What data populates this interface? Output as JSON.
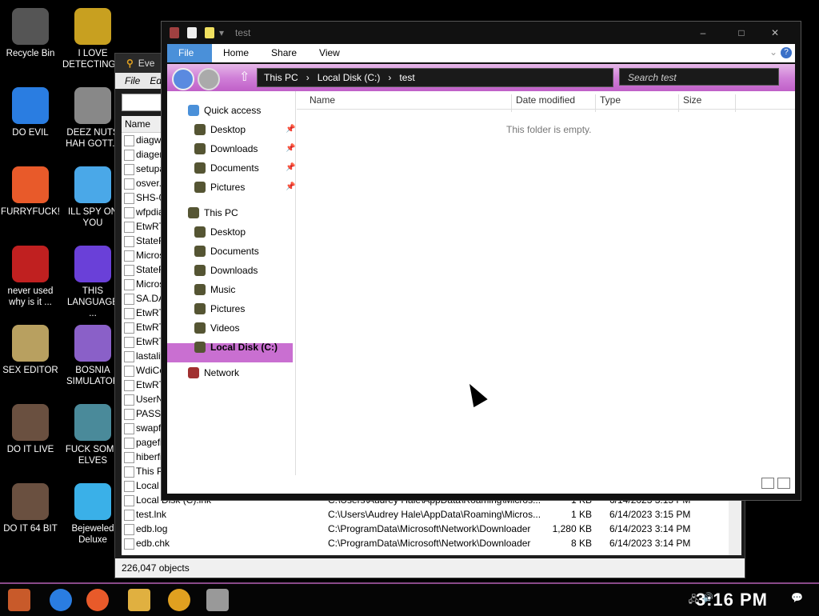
{
  "desktop_icons": [
    {
      "label": "Recycle Bin",
      "icon": "recycle-bin-icon",
      "color": "#555"
    },
    {
      "label": "I LOVE DETECTING...",
      "icon": "detect-it-easy-icon",
      "color": "#c8a020"
    },
    {
      "label": "DO EVIL",
      "icon": "chrome-icon",
      "color": "#2a7de1"
    },
    {
      "label": "DEEZ NUTS HAH GOTT...",
      "icon": "copy-windows-icon",
      "color": "#888"
    },
    {
      "label": "FURRYFUCK!",
      "icon": "firefox-icon",
      "color": "#e85a2a"
    },
    {
      "label": "ILL SPY ON YOU",
      "icon": "network-spy-icon",
      "color": "#4aa8e8"
    },
    {
      "label": "never used why is it ...",
      "icon": "dev-cpp-icon",
      "color": "#c02020"
    },
    {
      "label": "THIS LANGUAGE ...",
      "icon": "goland-icon",
      "color": "#6a40d8"
    },
    {
      "label": "SEX EDITOR",
      "icon": "hxd-icon",
      "color": "#b8a060"
    },
    {
      "label": "BOSNIA SIMULATOR",
      "icon": "mine-icon",
      "color": "#8a60c8"
    },
    {
      "label": "DO IT LIVE",
      "icon": "portrait-icon",
      "color": "#6a5040"
    },
    {
      "label": "FUCK SOME ELVES",
      "icon": "elf-icon",
      "color": "#4a8a9a"
    },
    {
      "label": "DO IT 64 BIT",
      "icon": "portrait-64-icon",
      "color": "#6a5040"
    },
    {
      "label": "Bejeweled Deluxe",
      "icon": "diamond-icon",
      "color": "#3ab0e8"
    }
  ],
  "background_window": {
    "title": "Eve",
    "menu": [
      "File",
      "Ed"
    ],
    "header_name": "Name",
    "rows": [
      {
        "name": "diagwr",
        "path": "",
        "size": "",
        "date": ""
      },
      {
        "name": "diager",
        "path": "",
        "size": "",
        "date": ""
      },
      {
        "name": "setupa",
        "path": "",
        "size": "",
        "date": ""
      },
      {
        "name": "osver.",
        "path": "",
        "size": "",
        "date": ""
      },
      {
        "name": "SHS-0",
        "path": "",
        "size": "",
        "date": ""
      },
      {
        "name": "wfpdia",
        "path": "",
        "size": "",
        "date": ""
      },
      {
        "name": "EtwRT",
        "path": "",
        "size": "",
        "date": ""
      },
      {
        "name": "StateR",
        "path": "",
        "size": "",
        "date": ""
      },
      {
        "name": "Micros",
        "path": "",
        "size": "",
        "date": ""
      },
      {
        "name": "StateR",
        "path": "",
        "size": "",
        "date": ""
      },
      {
        "name": "Micros",
        "path": "",
        "size": "",
        "date": ""
      },
      {
        "name": "SA.DA",
        "path": "",
        "size": "",
        "date": ""
      },
      {
        "name": "EtwRT",
        "path": "",
        "size": "",
        "date": ""
      },
      {
        "name": "EtwRT",
        "path": "",
        "size": "",
        "date": ""
      },
      {
        "name": "EtwRT",
        "path": "",
        "size": "",
        "date": ""
      },
      {
        "name": "lastaliv",
        "path": "",
        "size": "",
        "date": ""
      },
      {
        "name": "WdiCo",
        "path": "",
        "size": "",
        "date": ""
      },
      {
        "name": "EtwRT",
        "path": "",
        "size": "",
        "date": ""
      },
      {
        "name": "UserN",
        "path": "",
        "size": "",
        "date": ""
      },
      {
        "name": "PASSW",
        "path": "",
        "size": "",
        "date": ""
      },
      {
        "name": "swapfi",
        "path": "",
        "size": "",
        "date": ""
      },
      {
        "name": "pagefil",
        "path": "",
        "size": "",
        "date": ""
      },
      {
        "name": "hiberfil",
        "path": "",
        "size": "",
        "date": ""
      },
      {
        "name": "This PC",
        "path": "",
        "size": "",
        "date": ""
      },
      {
        "name": "Local D",
        "path": "",
        "size": "",
        "date": ""
      },
      {
        "name": "Local Disk (C).lnk",
        "path": "C:\\Users\\Audrey Hale\\AppData\\Roaming\\Micros...",
        "size": "1 KB",
        "date": "6/14/2023 3:15 PM"
      },
      {
        "name": "test.lnk",
        "path": "C:\\Users\\Audrey Hale\\AppData\\Roaming\\Micros...",
        "size": "1 KB",
        "date": "6/14/2023 3:15 PM"
      },
      {
        "name": "edb.log",
        "path": "C:\\ProgramData\\Microsoft\\Network\\Downloader",
        "size": "1,280 KB",
        "date": "6/14/2023 3:14 PM"
      },
      {
        "name": "edb.chk",
        "path": "C:\\ProgramData\\Microsoft\\Network\\Downloader",
        "size": "8 KB",
        "date": "6/14/2023 3:14 PM"
      }
    ],
    "status": "226,047 objects"
  },
  "explorer": {
    "title": "test",
    "ribbon_tabs": [
      "File",
      "Home",
      "Share",
      "View"
    ],
    "address": [
      "This PC",
      "Local Disk (C:)",
      "test"
    ],
    "search_placeholder": "Search test",
    "nav": [
      {
        "label": "Quick access",
        "icon": "star-icon",
        "indent": 0,
        "pinned": false
      },
      {
        "label": "Desktop",
        "icon": "desktop-icon",
        "indent": 1,
        "pinned": true
      },
      {
        "label": "Downloads",
        "icon": "downloads-icon",
        "indent": 1,
        "pinned": true
      },
      {
        "label": "Documents",
        "icon": "documents-icon",
        "indent": 1,
        "pinned": true
      },
      {
        "label": "Pictures",
        "icon": "pictures-icon",
        "indent": 1,
        "pinned": true
      },
      {
        "label": "This PC",
        "icon": "computer-icon",
        "indent": 0,
        "pinned": false
      },
      {
        "label": "Desktop",
        "icon": "desktop-icon",
        "indent": 1,
        "pinned": false
      },
      {
        "label": "Documents",
        "icon": "documents-icon",
        "indent": 1,
        "pinned": false
      },
      {
        "label": "Downloads",
        "icon": "downloads-icon",
        "indent": 1,
        "pinned": false
      },
      {
        "label": "Music",
        "icon": "music-icon",
        "indent": 1,
        "pinned": false
      },
      {
        "label": "Pictures",
        "icon": "pictures-icon",
        "indent": 1,
        "pinned": false
      },
      {
        "label": "Videos",
        "icon": "videos-icon",
        "indent": 1,
        "pinned": false
      },
      {
        "label": "Local Disk (C:)",
        "icon": "drive-icon",
        "indent": 1,
        "pinned": false,
        "selected": true
      },
      {
        "label": "Network",
        "icon": "network-icon",
        "indent": 0,
        "pinned": false
      }
    ],
    "columns": [
      "Name",
      "Date modified",
      "Type",
      "Size"
    ],
    "empty_text": "This folder is empty."
  },
  "taskbar": {
    "clock": "3:16 PM"
  }
}
